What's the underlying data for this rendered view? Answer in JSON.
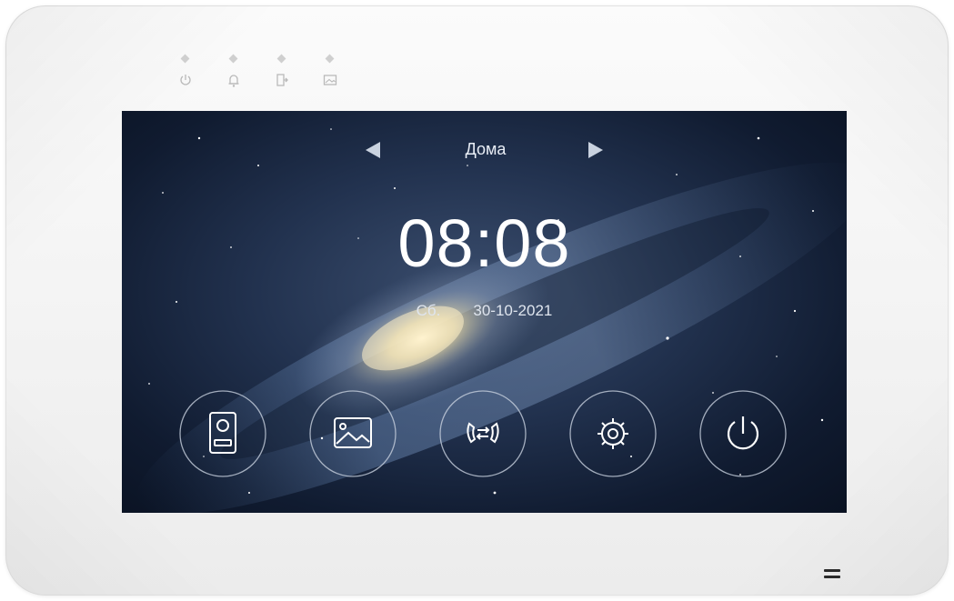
{
  "indicators": [
    {
      "name": "power",
      "icon": "power-icon"
    },
    {
      "name": "alarm",
      "icon": "bell-icon"
    },
    {
      "name": "door",
      "icon": "door-exit-icon"
    },
    {
      "name": "message",
      "icon": "image-message-icon"
    }
  ],
  "screen": {
    "location_title": "Дома",
    "prev_icon": "triangle-left-icon",
    "next_icon": "triangle-right-icon",
    "time": "08:08",
    "weekday": "Сб.",
    "date": "30-10-2021"
  },
  "menu": [
    {
      "name": "doorbell-monitor",
      "icon": "door-panel-icon"
    },
    {
      "name": "gallery",
      "icon": "picture-icon"
    },
    {
      "name": "intercom",
      "icon": "intercom-call-icon"
    },
    {
      "name": "settings",
      "icon": "gear-icon"
    },
    {
      "name": "power",
      "icon": "power-icon"
    }
  ],
  "colors": {
    "bezel": "#f4f4f4",
    "screen_dark": "#0f1a2e",
    "screen_light": "#3b4e6e",
    "icon_line": "#ffffff"
  }
}
